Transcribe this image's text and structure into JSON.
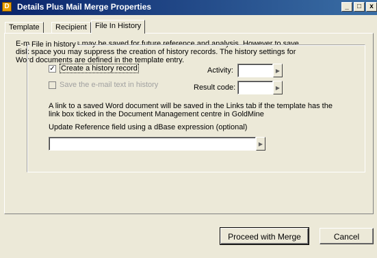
{
  "window": {
    "title": "Details Plus Mail Merge Properties",
    "app_icon_glyph": "D",
    "controls": {
      "minimize": "_",
      "maximize": "□",
      "close": "x"
    }
  },
  "tabs": [
    {
      "label": "Template",
      "active": false
    },
    {
      "label": "Recipient",
      "active": false
    },
    {
      "label": "File In History",
      "active": true
    }
  ],
  "panel": {
    "intro_lines": [
      "E-mails documents may be saved for future reference and analysis. However to save",
      "disk space you may suppress the creation of history records. The history settings for",
      "Word documents are defined in the template entry."
    ],
    "group": {
      "legend": "File in history",
      "create_history": {
        "label": "Create a history record",
        "checked": true
      },
      "save_email_text": {
        "label": "Save the e-mail text in history",
        "checked": false,
        "enabled": false
      },
      "activity": {
        "label": "Activity:",
        "value": ""
      },
      "result_code": {
        "label": "Result code:",
        "value": ""
      },
      "link_note_lines": [
        "A link to a saved Word document will be saved in the Links tab if the template has the",
        "link box ticked in the Document Management centre in GoldMine"
      ],
      "update_ref_label": "Update Reference field using a dBase expression (optional)",
      "update_ref_value": ""
    }
  },
  "buttons": {
    "proceed": "Proceed with Merge",
    "cancel": "Cancel"
  },
  "icons": {
    "arrow": "arrow-right-icon",
    "check": "check-icon"
  }
}
